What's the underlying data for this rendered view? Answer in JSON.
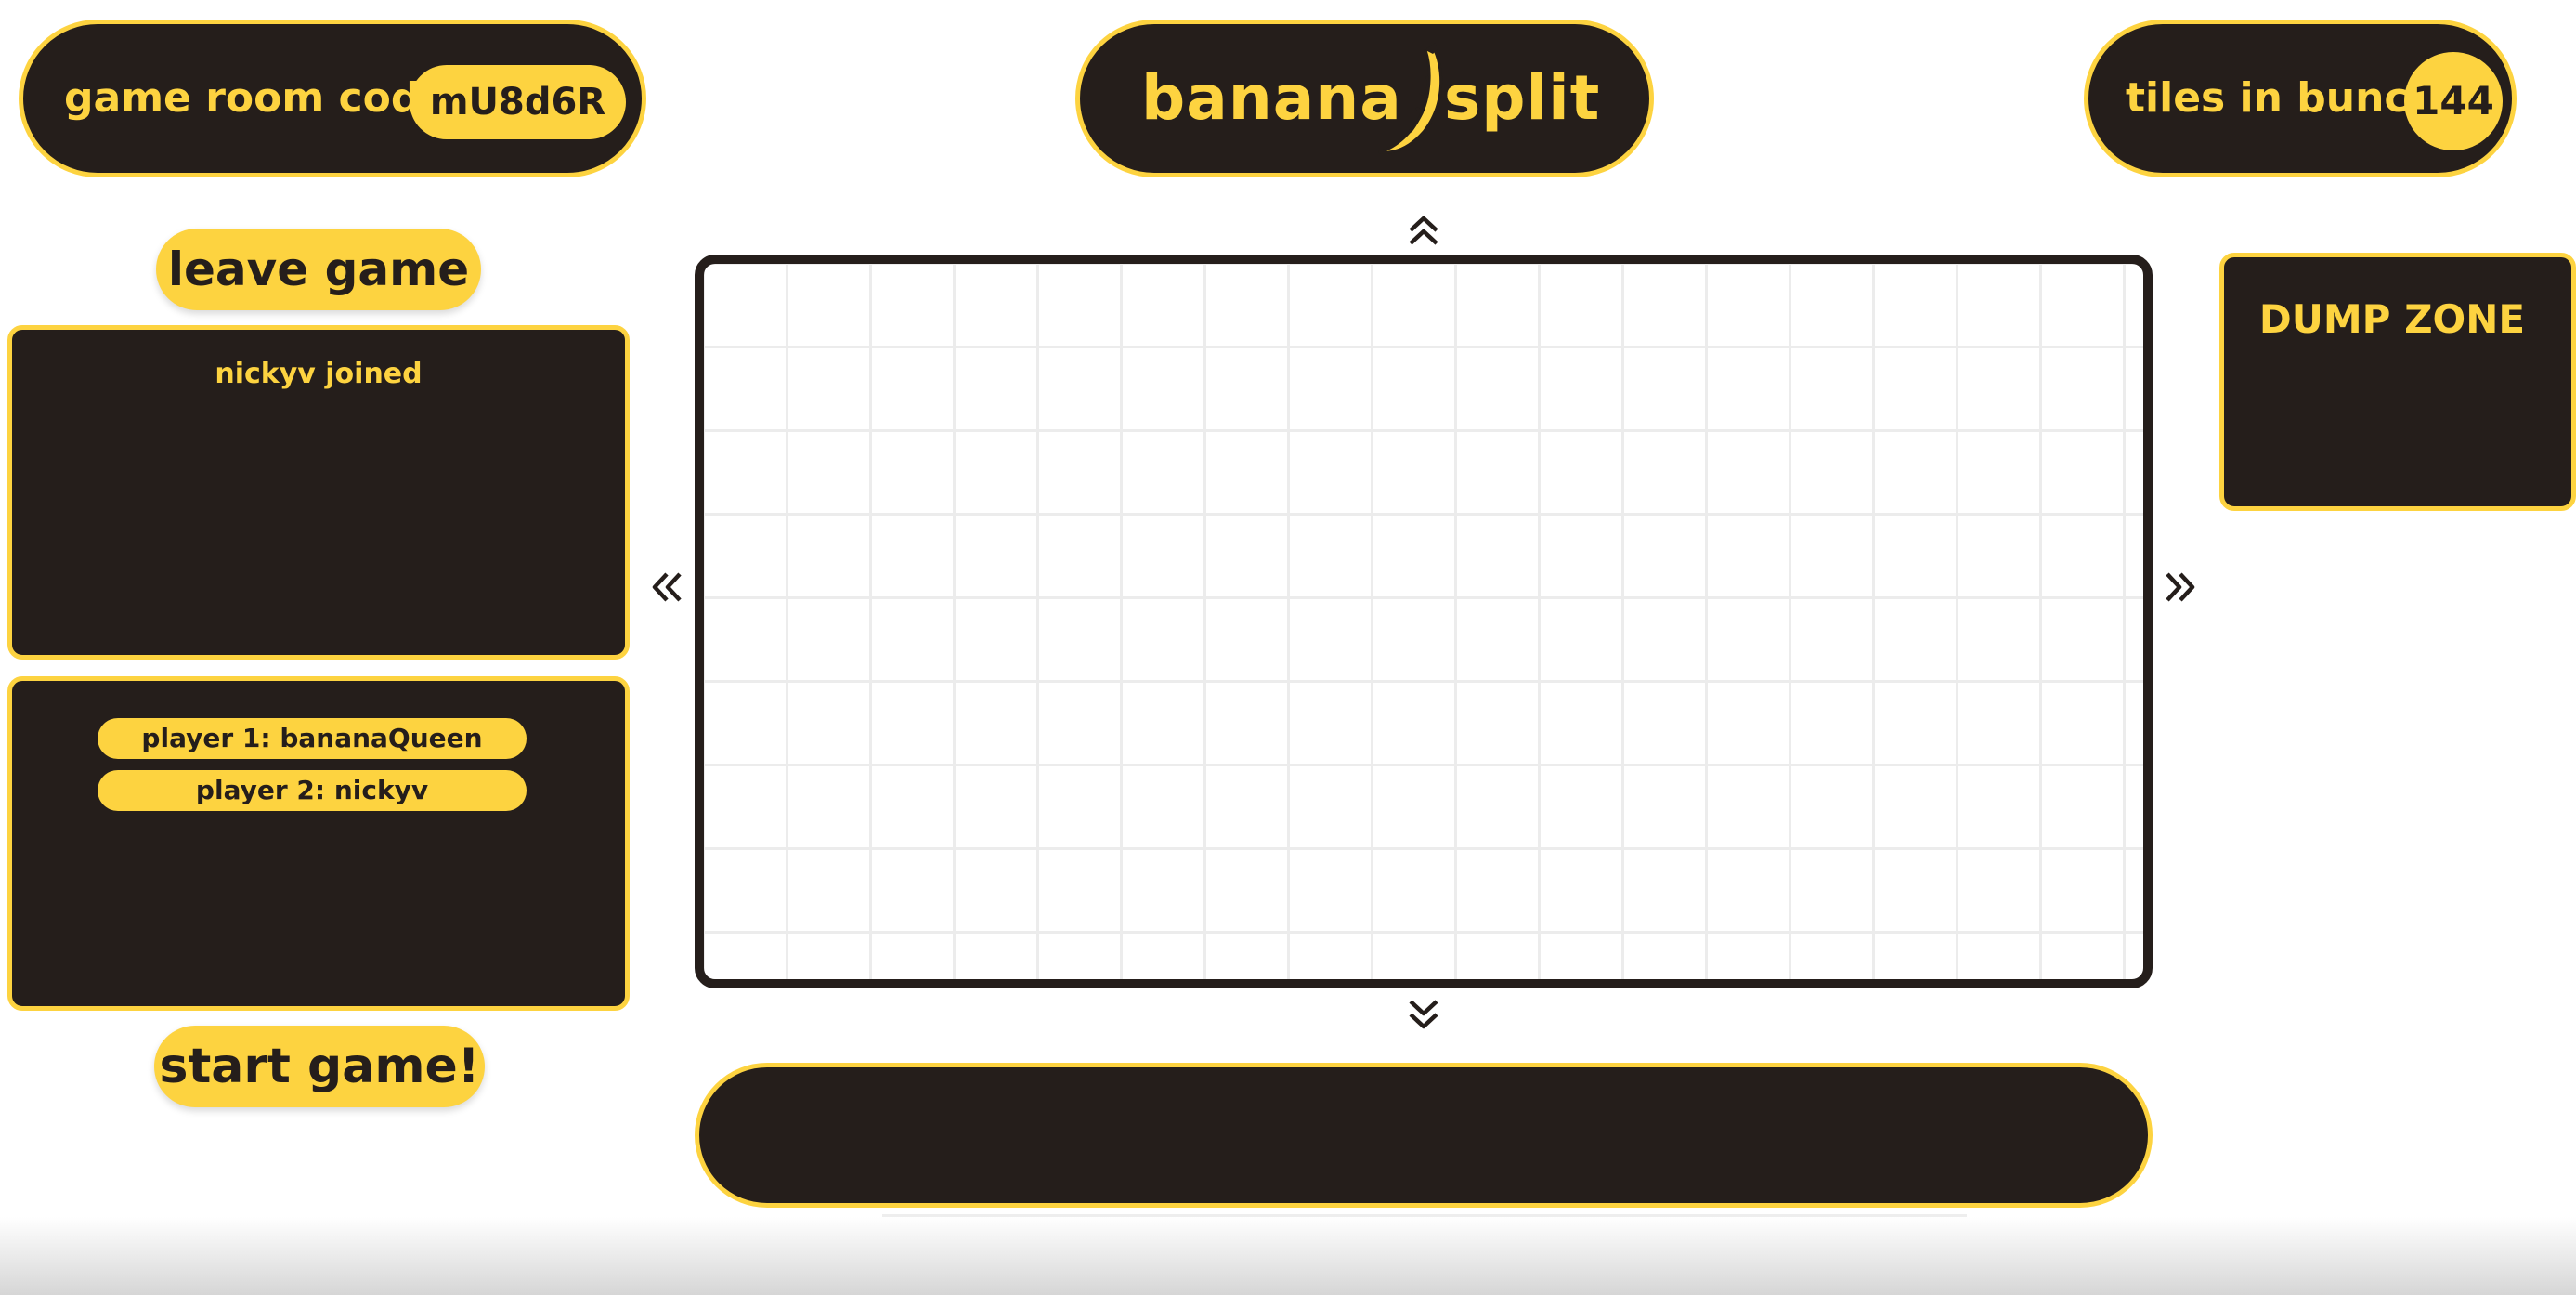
{
  "header": {
    "room_label": "game room code:",
    "room_code": "mU8d6R",
    "logo_left": "banana",
    "logo_right": "split",
    "tiles_label": "tiles in bunch:",
    "tiles_count": "144"
  },
  "left_panel": {
    "leave_label": "leave game",
    "log_messages": [
      "nickyv joined"
    ],
    "players": [
      "player 1: bananaQueen",
      "player 2: nickyv"
    ],
    "start_label": "start game!"
  },
  "dump_zone": {
    "label": "DUMP ZONE"
  },
  "icons": {
    "logo": "banana-icon",
    "pan_up": "double-chevron-up-icon",
    "pan_down": "double-chevron-down-icon",
    "pan_left": "double-chevron-left-icon",
    "pan_right": "double-chevron-right-icon"
  },
  "colors": {
    "accent": "#fdd340",
    "dark": "#251e1b",
    "grid": "#ececec",
    "background": "#ffffff"
  }
}
